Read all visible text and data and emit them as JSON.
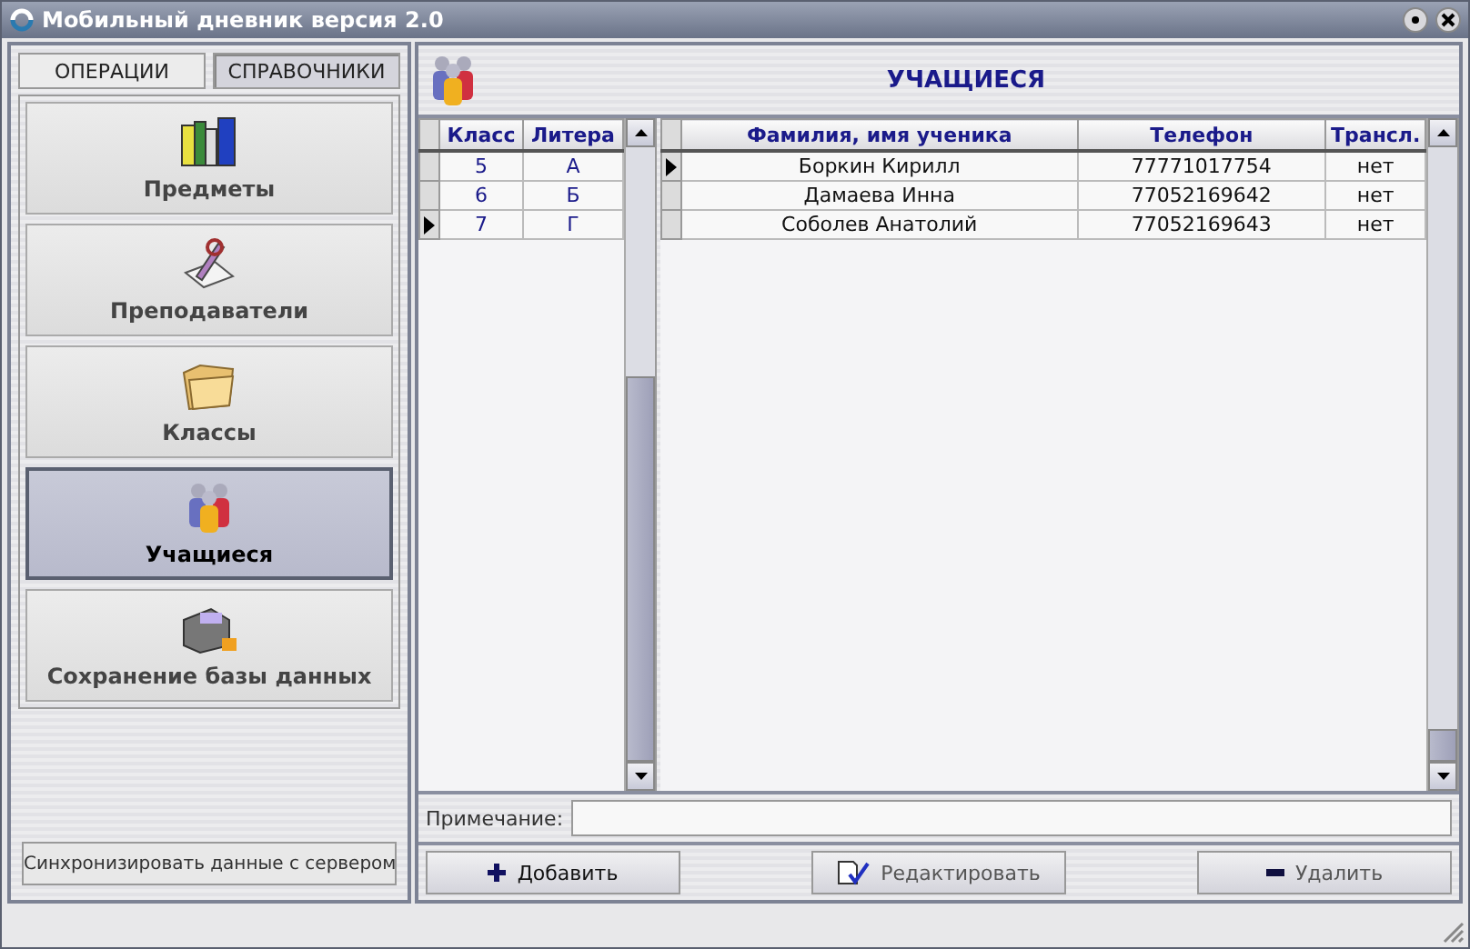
{
  "window": {
    "title": "Мобильный дневник версия 2.0"
  },
  "tabs": [
    {
      "label": "ОПЕРАЦИИ",
      "selected": false
    },
    {
      "label": "СПРАВОЧНИКИ",
      "selected": true
    }
  ],
  "nav_items": [
    {
      "kind": "books",
      "label": "Предметы",
      "selected": false
    },
    {
      "kind": "teacher",
      "label": "Преподаватели",
      "selected": false
    },
    {
      "kind": "folder",
      "label": "Классы",
      "selected": false
    },
    {
      "kind": "people",
      "label": "Учащиеся",
      "selected": true
    },
    {
      "kind": "save",
      "label": "Сохранение базы данных",
      "selected": false
    }
  ],
  "sync_button": "Синхронизировать данные с сервером",
  "section_title": "УЧАЩИЕСЯ",
  "classes_table": {
    "columns": [
      "Класс",
      "Литера"
    ],
    "rows": [
      {
        "cells": [
          "5",
          "А"
        ],
        "selected": false
      },
      {
        "cells": [
          "6",
          "Б"
        ],
        "selected": false
      },
      {
        "cells": [
          "7",
          "Г"
        ],
        "selected": true
      }
    ]
  },
  "students_table": {
    "columns": [
      "Фамилия, имя ученика",
      "Телефон",
      "Трансл."
    ],
    "rows": [
      {
        "cells": [
          "Боркин Кирилл",
          "77771017754",
          "нет"
        ],
        "selected": true
      },
      {
        "cells": [
          "Дамаева Инна",
          "77052169642",
          "нет"
        ],
        "selected": false
      },
      {
        "cells": [
          "Соболев Анатолий",
          "77052169643",
          "нет"
        ],
        "selected": false
      }
    ]
  },
  "note": {
    "label": "Примечание:"
  },
  "buttons": [
    {
      "kind": "add",
      "label": "Добавить"
    },
    {
      "kind": "edit",
      "label": "Редактировать"
    },
    {
      "kind": "delete",
      "label": "Удалить"
    }
  ]
}
